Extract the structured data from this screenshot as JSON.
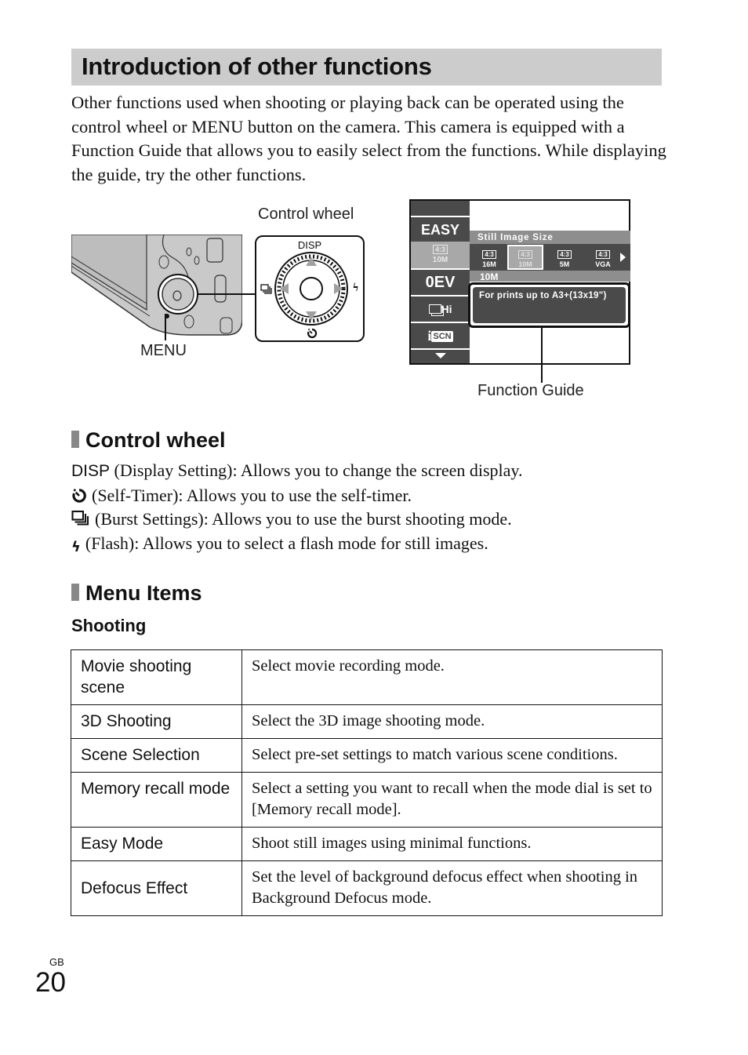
{
  "header": {
    "title": "Introduction of other functions",
    "title_bar_color": "#cccccc"
  },
  "intro_text": "Other functions used when shooting or playing back can be operated using the control wheel or MENU button on the camera. This camera is equipped with a Function Guide that allows you to easily select from the functions. While displaying the guide, try the other functions.",
  "figure": {
    "control_wheel_label": "Control wheel",
    "menu_label": "MENU",
    "function_guide_label": "Function Guide",
    "wheel": {
      "top_label": "DISP",
      "icons": [
        "burst-icon",
        "flash-icon",
        "self-timer-icon"
      ]
    },
    "screen": {
      "sidebar_items": [
        {
          "label": "EASY",
          "icon": "easy-mode"
        },
        {
          "ratio": "4:3",
          "size": "10M",
          "selected": true
        },
        {
          "label": "0EV",
          "icon": "exposure"
        },
        {
          "label": "Hi",
          "icon": "burst-hi"
        },
        {
          "label": "SCN",
          "icon": "intelligent-scene"
        },
        {
          "icon": "down-arrow"
        }
      ],
      "menu_title": "Still Image Size",
      "options": [
        {
          "ratio": "4:3",
          "size": "16M",
          "selected": false
        },
        {
          "ratio": "4:3",
          "size": "10M",
          "selected": true
        },
        {
          "ratio": "4:3",
          "size": "5M",
          "selected": false
        },
        {
          "ratio": "4:3",
          "size": "VGA",
          "selected": false
        }
      ],
      "current_value": "10M",
      "guide_text": "For prints up to A3+(13x19\")"
    }
  },
  "control_wheel_section": {
    "heading": "Control wheel",
    "items": [
      {
        "key": "DISP",
        "text": "(Display Setting): Allows you to change the screen display."
      },
      {
        "icon": "self-timer-icon",
        "text": "(Self-Timer): Allows you to use the self-timer."
      },
      {
        "icon": "burst-icon",
        "text": "(Burst Settings): Allows you to use the burst shooting mode."
      },
      {
        "icon": "flash-icon",
        "text": "(Flash): Allows you to select a flash mode for still images."
      }
    ]
  },
  "menu_items_section": {
    "heading": "Menu Items",
    "subheading": "Shooting",
    "rows": [
      {
        "name": "Movie shooting scene",
        "description": "Select movie recording mode."
      },
      {
        "name": "3D Shooting",
        "description": "Select the 3D image shooting mode."
      },
      {
        "name": "Scene Selection",
        "description": "Select pre-set settings to match various scene conditions."
      },
      {
        "name": "Memory recall mode",
        "description": "Select a setting you want to recall when the mode dial is set to [Memory recall mode]."
      },
      {
        "name": "Easy Mode",
        "description": "Shoot still images using minimal functions."
      },
      {
        "name": "Defocus Effect",
        "description": "Set the level of background defocus effect when shooting in Background Defocus mode."
      }
    ]
  },
  "footer": {
    "language": "GB",
    "page_number": "20"
  }
}
